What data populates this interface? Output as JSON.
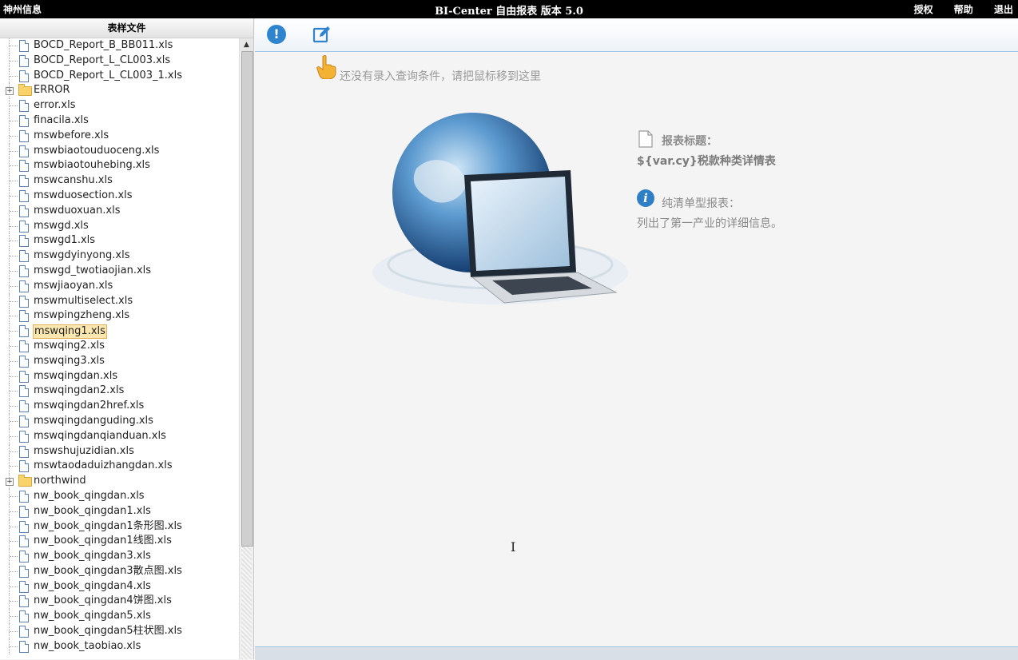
{
  "topbar": {
    "brand": "神州信息",
    "title": "BI-Center 自由报表 版本 5.0",
    "links": {
      "license": "授权",
      "help": "帮助",
      "logout": "退出"
    }
  },
  "sidebar": {
    "title": "表样文件",
    "items": [
      {
        "label": "BOCD_Report_B_BB011.xls",
        "type": "file"
      },
      {
        "label": "BOCD_Report_L_CL003.xls",
        "type": "file"
      },
      {
        "label": "BOCD_Report_L_CL003_1.xls",
        "type": "file"
      },
      {
        "label": "ERROR",
        "type": "folder"
      },
      {
        "label": "error.xls",
        "type": "file"
      },
      {
        "label": "finacila.xls",
        "type": "file"
      },
      {
        "label": "mswbefore.xls",
        "type": "file"
      },
      {
        "label": "mswbiaotouduoceng.xls",
        "type": "file"
      },
      {
        "label": "mswbiaotouhebing.xls",
        "type": "file"
      },
      {
        "label": "mswcanshu.xls",
        "type": "file"
      },
      {
        "label": "mswduosection.xls",
        "type": "file"
      },
      {
        "label": "mswduoxuan.xls",
        "type": "file"
      },
      {
        "label": "mswgd.xls",
        "type": "file"
      },
      {
        "label": "mswgd1.xls",
        "type": "file"
      },
      {
        "label": "mswgdyinyong.xls",
        "type": "file"
      },
      {
        "label": "mswgd_twotiaojian.xls",
        "type": "file"
      },
      {
        "label": "mswjiaoyan.xls",
        "type": "file"
      },
      {
        "label": "mswmultiselect.xls",
        "type": "file"
      },
      {
        "label": "mswpingzheng.xls",
        "type": "file"
      },
      {
        "label": "mswqing1.xls",
        "type": "file",
        "selected": true
      },
      {
        "label": "mswqing2.xls",
        "type": "file"
      },
      {
        "label": "mswqing3.xls",
        "type": "file"
      },
      {
        "label": "mswqingdan.xls",
        "type": "file"
      },
      {
        "label": "mswqingdan2.xls",
        "type": "file"
      },
      {
        "label": "mswqingdan2href.xls",
        "type": "file"
      },
      {
        "label": "mswqingdanguding.xls",
        "type": "file"
      },
      {
        "label": "mswqingdanqianduan.xls",
        "type": "file"
      },
      {
        "label": "mswshujuzidian.xls",
        "type": "file"
      },
      {
        "label": "mswtaodaduizhangdan.xls",
        "type": "file"
      },
      {
        "label": "northwind",
        "type": "folder"
      },
      {
        "label": "nw_book_qingdan.xls",
        "type": "file"
      },
      {
        "label": "nw_book_qingdan1.xls",
        "type": "file"
      },
      {
        "label": "nw_book_qingdan1条形图.xls",
        "type": "file"
      },
      {
        "label": "nw_book_qingdan1线图.xls",
        "type": "file"
      },
      {
        "label": "nw_book_qingdan3.xls",
        "type": "file"
      },
      {
        "label": "nw_book_qingdan3散点图.xls",
        "type": "file"
      },
      {
        "label": "nw_book_qingdan4.xls",
        "type": "file"
      },
      {
        "label": "nw_book_qingdan4饼图.xls",
        "type": "file"
      },
      {
        "label": "nw_book_qingdan5.xls",
        "type": "file"
      },
      {
        "label": "nw_book_qingdan5柱状图.xls",
        "type": "file"
      },
      {
        "label": "nw_book_taobiao.xls",
        "type": "file"
      }
    ]
  },
  "main": {
    "hint": "还没有录入查询条件，请把鼠标移到这里",
    "report_title_label": "报表标题：",
    "report_title_value": "${var.cy}税款种类详情表",
    "report_type_label": "纯清单型报表：",
    "report_type_desc": "列出了第一产业的详细信息。"
  },
  "colors": {
    "accent": "#2f84d0",
    "topbar": "#000000",
    "selection": "#fde7b0"
  }
}
